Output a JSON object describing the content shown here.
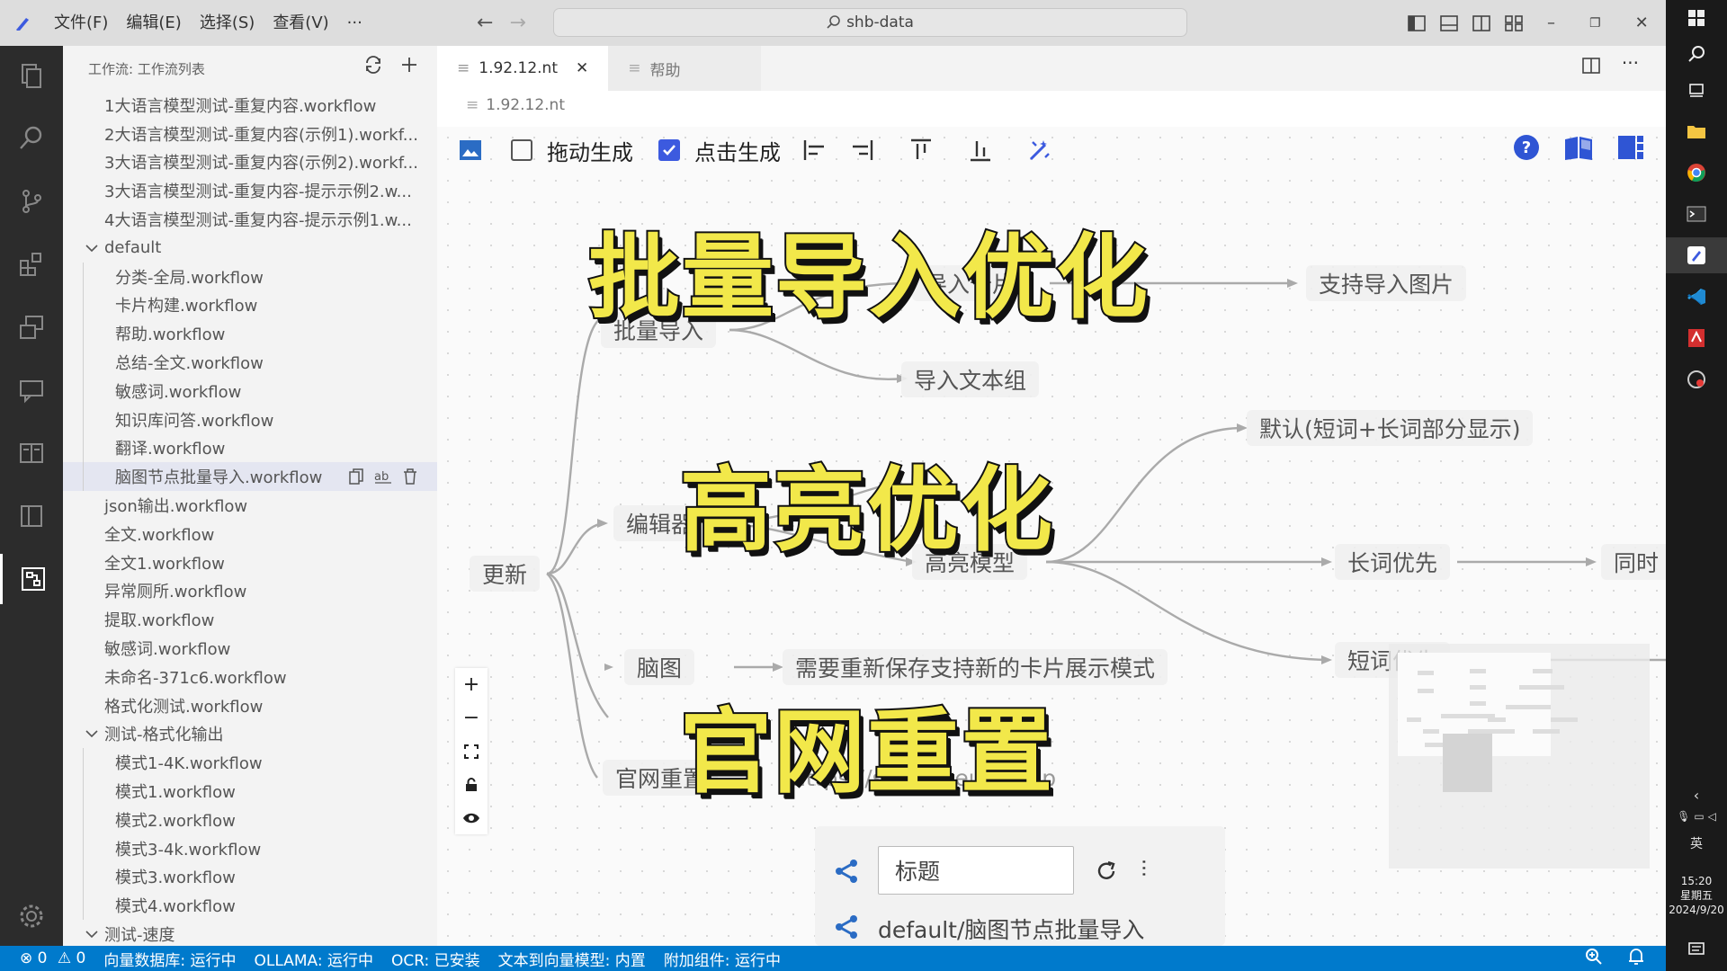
{
  "titlebar": {
    "menus": [
      "文件(F)",
      "编辑(E)",
      "选择(S)",
      "查看(V)",
      "···"
    ],
    "search_text": "shb-data",
    "accent": "#3c5adf"
  },
  "sidebar": {
    "title": "工作流: 工作流列表",
    "items": [
      {
        "label": "1大语言模型测试-重复内容.workflow",
        "level": 0
      },
      {
        "label": "2大语言模型测试-重复内容(示例1).workf...",
        "level": 0
      },
      {
        "label": "3大语言模型测试-重复内容(示例2).workf...",
        "level": 0
      },
      {
        "label": "3大语言模型测试-重复内容-提示示例2.w...",
        "level": 0
      },
      {
        "label": "4大语言模型测试-重复内容-提示示例1.w...",
        "level": 0
      },
      {
        "label": "default",
        "level": "folder"
      },
      {
        "label": "分类-全局.workflow",
        "level": 1
      },
      {
        "label": "卡片构建.workflow",
        "level": 1
      },
      {
        "label": "帮助.workflow",
        "level": 1
      },
      {
        "label": "总结-全文.workflow",
        "level": 1
      },
      {
        "label": "敏感词.workflow",
        "level": 1
      },
      {
        "label": "知识库问答.workflow",
        "level": 1
      },
      {
        "label": "翻译.workflow",
        "level": 1
      },
      {
        "label": "脑图节点批量导入.workflow",
        "level": 1,
        "selected": true
      },
      {
        "label": "json输出.workflow",
        "level": 0
      },
      {
        "label": "全文.workflow",
        "level": 0
      },
      {
        "label": "全文1.workflow",
        "level": 0
      },
      {
        "label": "异常厕所.workflow",
        "level": 0
      },
      {
        "label": "提取.workflow",
        "level": 0
      },
      {
        "label": "敏感词.workflow",
        "level": 0
      },
      {
        "label": "未命名-371c6.workflow",
        "level": 0
      },
      {
        "label": "格式化测试.workflow",
        "level": 0
      },
      {
        "label": "测试-格式化输出",
        "level": "folder"
      },
      {
        "label": "模式1-4K.workflow",
        "level": 1
      },
      {
        "label": "模式1.workflow",
        "level": 1
      },
      {
        "label": "模式2.workflow",
        "level": 1
      },
      {
        "label": "模式3-4k.workflow",
        "level": 1
      },
      {
        "label": "模式3.workflow",
        "level": 1
      },
      {
        "label": "模式4.workflow",
        "level": 1
      },
      {
        "label": "测试-速度",
        "level": "folder"
      }
    ]
  },
  "editor": {
    "tabs": [
      {
        "label": "1.92.12.nt",
        "active": true
      },
      {
        "label": "帮助",
        "active": false
      }
    ],
    "breadcrumb": "1.92.12.nt",
    "toolbar": {
      "drag_label": "拖动生成",
      "drag_checked": false,
      "click_label": "点击生成",
      "click_checked": true
    }
  },
  "mindmap": {
    "root": "更新",
    "nodes": {
      "batch_import": "批量导入",
      "import_card": "导入卡片",
      "support_image": "支持导入图片",
      "import_text": "导入文本组",
      "editor": "编辑器",
      "default_mode": "默认(短词+长词部分显示)",
      "highlight_model": "高亮模型",
      "long_first": "长词优先",
      "same_time": "同时",
      "short_first": "短词优先",
      "mindmap": "脑图",
      "resave": "需要重新保存支持新的卡片展示模式",
      "official_reset": "官网重置",
      "url": "https://shengheubit.top"
    }
  },
  "overlay": {
    "line1": "批量导入优化",
    "line2": "高亮优化",
    "line3": "官网重置"
  },
  "bottom_panel": {
    "title_value": "标题",
    "path": "default/脑图节点批量导入"
  },
  "statusbar": {
    "errors": "0",
    "warnings": "0",
    "items": [
      "向量数据库: 运行中",
      "OLLAMA: 运行中",
      "OCR: 已安装",
      "文本到向量模型: 内置",
      "附加组件: 运行中"
    ]
  },
  "taskbar": {
    "ime": "英",
    "time": "15:20",
    "weekday": "星期五",
    "date": "2024/9/20"
  }
}
